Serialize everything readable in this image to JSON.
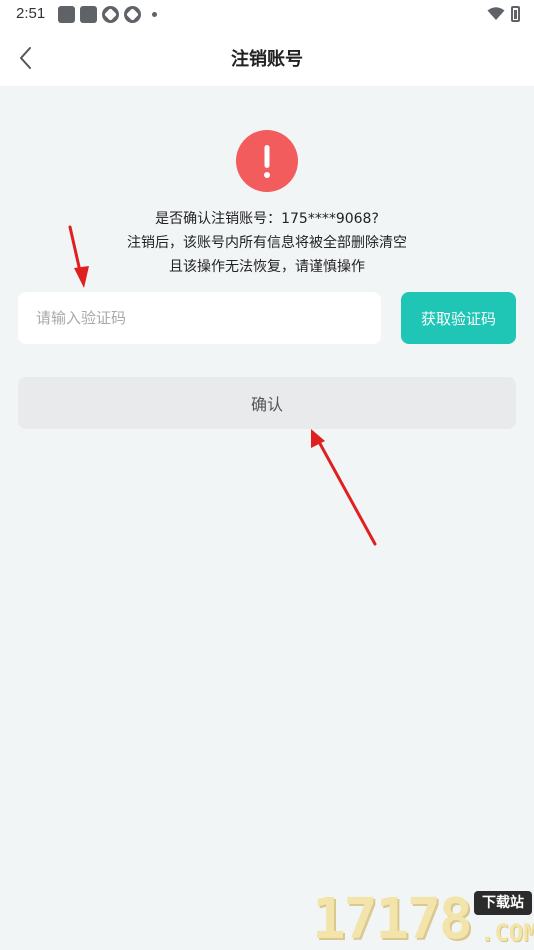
{
  "status_bar": {
    "time": "2:51",
    "icons": [
      "app-notification-icon",
      "app-notification-icon",
      "sync-icon",
      "sync-icon",
      "more-dot-icon",
      "wifi-icon",
      "battery-icon"
    ]
  },
  "header": {
    "title": "注销账号",
    "back_icon": "chevron-left-icon"
  },
  "warning": {
    "icon": "exclamation-icon",
    "color": "#f25c5c",
    "line1": "是否确认注销账号：175****9068?",
    "line2": "注销后，该账号内所有信息将被全部删除清空",
    "line3": "且该操作无法恢复，请谨慎操作"
  },
  "form": {
    "code_placeholder": "请输入验证码",
    "code_value": "",
    "get_code_label": "获取验证码",
    "get_code_color": "#1fc6b6",
    "confirm_label": "确认"
  },
  "watermark": {
    "digits": "17178",
    "badge": "下载站",
    "suffix": ".COM"
  }
}
